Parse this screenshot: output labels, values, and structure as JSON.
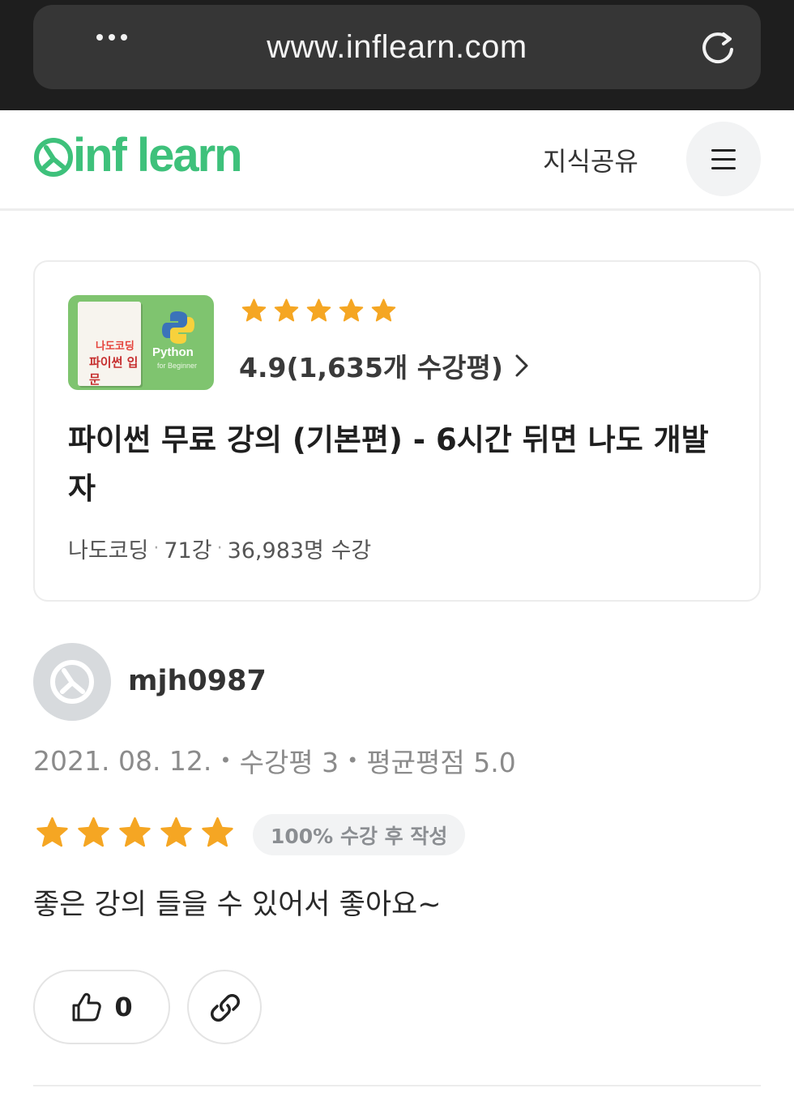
{
  "browser": {
    "url": "www.inflearn.com"
  },
  "header": {
    "logo_text": "inf learn",
    "nav_link": "지식공유"
  },
  "course": {
    "thumbnail": {
      "book_line1": "나도코딩",
      "book_line2": "파이썬 입문",
      "title": "Python",
      "subtitle": "for Beginner"
    },
    "stars": 5,
    "star_color": "#f5a623",
    "rating_text": "4.9(1,635개 수강평)",
    "title": "파이썬 무료 강의 (기본편) - 6시간 뒤면 나도 개발자",
    "meta": {
      "author": "나도코딩",
      "lectures": "71강",
      "students": "36,983명 수강"
    }
  },
  "review": {
    "username": "mjh0987",
    "date": "2021. 08. 12.",
    "review_count": "수강평 3",
    "average_rating": "평균평점 5.0",
    "stars": 5,
    "badge": "100% 수강 후 작성",
    "body": "좋은 강의 들을 수 있어서 좋아요~",
    "likes": "0"
  },
  "colors": {
    "brand": "#3ec17b",
    "chrome": "#1e1e1e",
    "star": "#f5a623"
  }
}
